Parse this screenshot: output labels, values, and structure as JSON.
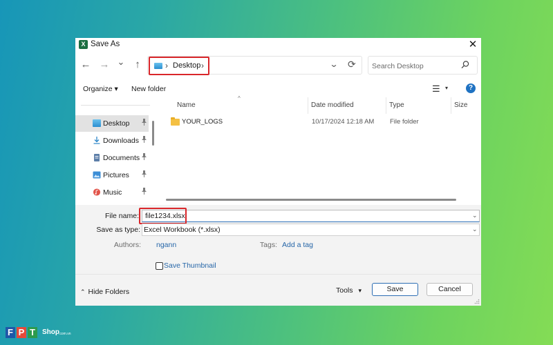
{
  "window": {
    "title": "Save As",
    "close_glyph": "✕",
    "app_icon_letter": "X"
  },
  "nav": {
    "back_glyph": "←",
    "forward_glyph": "→",
    "recent_glyph": "⌄",
    "up_glyph": "↑",
    "breadcrumb": [
      "Desktop"
    ],
    "chevron": "›",
    "dropdown_glyph": "⌄",
    "refresh_glyph": "⟳"
  },
  "search": {
    "placeholder": "Search Desktop"
  },
  "toolbar": {
    "organize_label": "Organize ▾",
    "new_folder_label": "New folder",
    "view_glyph": "☰",
    "view_caret": "▾",
    "help_glyph": "?"
  },
  "sidebar": {
    "items": [
      {
        "label": "Desktop",
        "icon": "desktop-icon",
        "selected": true
      },
      {
        "label": "Downloads",
        "icon": "download-icon",
        "selected": false
      },
      {
        "label": "Documents",
        "icon": "documents-icon",
        "selected": false
      },
      {
        "label": "Pictures",
        "icon": "pictures-icon",
        "selected": false
      },
      {
        "label": "Music",
        "icon": "music-icon",
        "selected": false
      }
    ],
    "pin_glyph": "📌"
  },
  "filelist": {
    "columns": [
      "Name",
      "Date modified",
      "Type",
      "Size"
    ],
    "sort_glyph": "^",
    "rows": [
      {
        "name": "YOUR_LOGS",
        "date_modified": "10/17/2024 12:18 AM",
        "type": "File folder",
        "size": ""
      }
    ]
  },
  "form": {
    "file_name_label": "File name:",
    "file_name_value": "file1234.xlsx",
    "save_as_type_label": "Save as type:",
    "save_as_type_value": "Excel Workbook (*.xlsx)",
    "authors_label": "Authors:",
    "authors_value": "ngann",
    "tags_label": "Tags:",
    "tags_value": "Add a tag",
    "thumbnail_label": "Save Thumbnail",
    "dropdown_glyph": "⌄"
  },
  "footer": {
    "hide_folders_label": "Hide Folders",
    "hide_folders_glyph": "⌃",
    "tools_label": "Tools",
    "tools_caret": "▾",
    "save_label": "Save",
    "cancel_label": "Cancel"
  },
  "watermark": {
    "letters": [
      "F",
      "P",
      "T"
    ],
    "shop": "Shop",
    "tld": ".com.vn"
  },
  "colors": {
    "highlight_red": "#d9262a",
    "link_blue": "#2666a8",
    "folder_yellow": "#f4c043",
    "excel_green": "#1d6f42"
  }
}
